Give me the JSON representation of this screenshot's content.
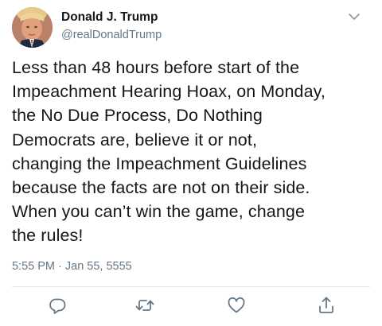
{
  "author": {
    "display_name": "Donald J. Trump",
    "handle": "@realDonaldTrump"
  },
  "tweet": {
    "text": "Less than 48 hours before start of the\nImpeachment Hearing Hoax, on Monday,\nthe No Due Process, Do Nothing\nDemocrats are, believe it or not,\nchanging the Impeachment Guidelines\nbecause the facts are not on their side.\nWhen you can’t win the game, change\nthe rules!",
    "timestamp": "5:55 PM · Jan 55, 5555"
  },
  "icons": {
    "menu": "chevron-down-icon",
    "reply": "reply-icon",
    "retweet": "retweet-icon",
    "like": "heart-icon",
    "share": "share-icon"
  },
  "colors": {
    "text": "#14171a",
    "secondary": "#657786",
    "icon": "#657786",
    "divider": "#e1e8ed"
  }
}
